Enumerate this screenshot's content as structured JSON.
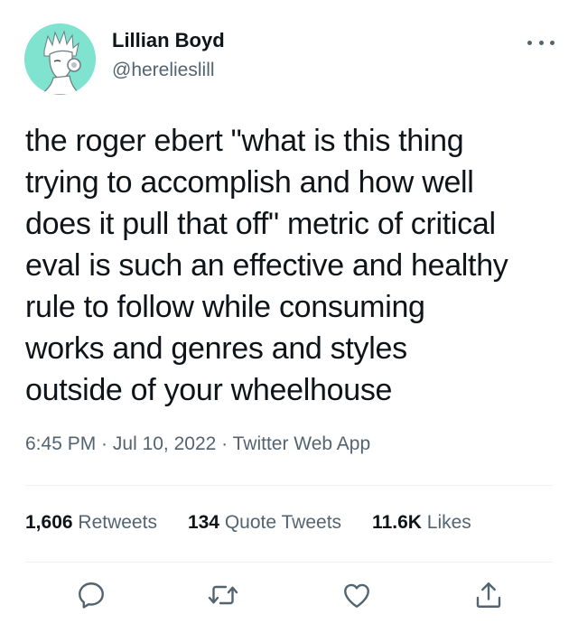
{
  "author": {
    "name": "Lillian Boyd",
    "handle": "@herelieslill",
    "avatar_icon": "avatar-illustration-icon"
  },
  "more_icon": "more-horizontal-icon",
  "tweet": {
    "lines": [
      "the roger ebert \"what is this thing",
      "trying to accomplish and how well",
      "does it pull that off\" metric of critical",
      "eval is such an effective and healthy",
      "rule to follow while consuming",
      "works and genres and styles",
      "outside of your wheelhouse"
    ]
  },
  "meta": {
    "time": "6:45 PM",
    "separator": " · ",
    "date": "Jul 10, 2022",
    "source": "Twitter Web App"
  },
  "stats": {
    "retweets": {
      "count": "1,606",
      "label": "Retweets"
    },
    "quotes": {
      "count": "134",
      "label": "Quote Tweets"
    },
    "likes": {
      "count": "11.6K",
      "label": "Likes"
    }
  },
  "actions": {
    "reply_icon": "reply-icon",
    "retweet_icon": "retweet-icon",
    "like_icon": "like-heart-icon",
    "share_icon": "share-icon"
  },
  "colors": {
    "text": "#0f1419",
    "secondary": "#536471",
    "divider": "#eff3f4",
    "avatar_bg": "#7fe3cf"
  }
}
